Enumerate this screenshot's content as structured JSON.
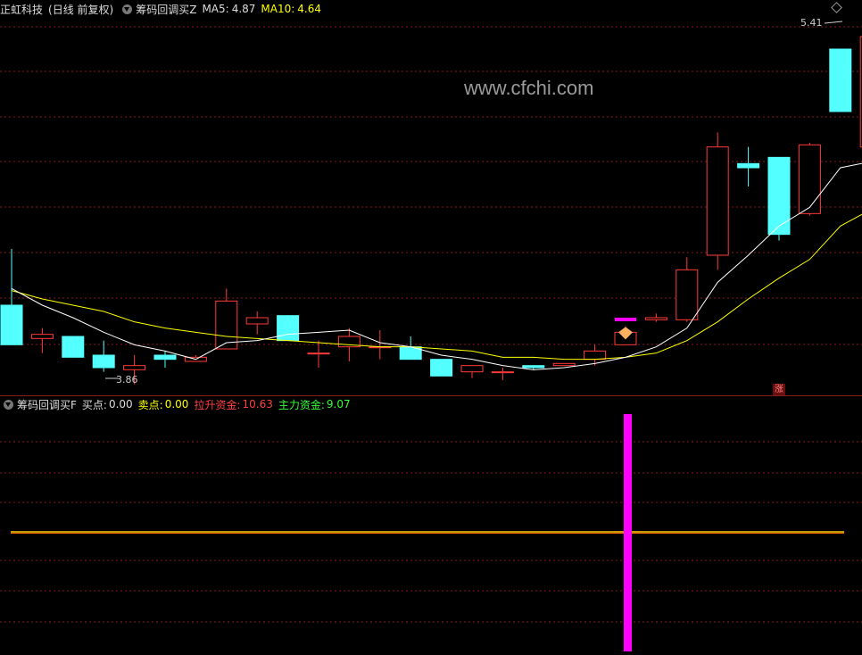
{
  "header": {
    "stock": "正虹科技",
    "period": "(日线 前复权)",
    "indicator": "筹码回调买Z",
    "ma5_label": "MA5:",
    "ma5_value": "4.87",
    "ma10_label": "MA10:",
    "ma10_value": "4.64"
  },
  "watermark": "www.cfchi.com",
  "annotations": {
    "high": "5.41",
    "low": "3.86",
    "zhang": "涨"
  },
  "sub_header": {
    "indicator": "筹码回调买F",
    "buy_label": "买点:",
    "buy_value": "0.00",
    "sell_label": "卖点:",
    "sell_value": "0.00",
    "lift_label": "拉升资金:",
    "lift_value": "10.63",
    "main_label": "主力资金:",
    "main_value": "9.07"
  },
  "chart_data": {
    "type": "candlestick",
    "colors": {
      "up": "#ff3a3a",
      "down": "#54ffff",
      "ma5": "#ffffff",
      "ma10": "#ffff00",
      "grid": "#8a1c1c",
      "signal": "#ff00ff"
    },
    "candles": [
      {
        "o": 4.18,
        "h": 4.45,
        "l": 4.04,
        "c": 3.99
      },
      {
        "o": 4.02,
        "h": 4.07,
        "l": 3.95,
        "c": 4.04
      },
      {
        "o": 4.03,
        "h": 4.03,
        "l": 3.97,
        "c": 3.93
      },
      {
        "o": 3.94,
        "h": 4.01,
        "l": 3.86,
        "c": 3.88
      },
      {
        "o": 3.87,
        "h": 3.94,
        "l": 3.8,
        "c": 3.89
      },
      {
        "o": 3.94,
        "h": 3.96,
        "l": 3.88,
        "c": 3.92
      },
      {
        "o": 3.91,
        "h": 3.94,
        "l": 3.91,
        "c": 3.93
      },
      {
        "o": 3.97,
        "h": 4.26,
        "l": 3.97,
        "c": 4.2
      },
      {
        "o": 4.09,
        "h": 4.15,
        "l": 4.04,
        "c": 4.12
      },
      {
        "o": 4.13,
        "h": 4.13,
        "l": 4.01,
        "c": 4.01
      },
      {
        "o": 3.95,
        "h": 4.01,
        "l": 3.88,
        "c": 3.95
      },
      {
        "o": 3.98,
        "h": 4.07,
        "l": 3.91,
        "c": 4.03
      },
      {
        "o": 3.98,
        "h": 4.06,
        "l": 3.92,
        "c": 3.98
      },
      {
        "o": 3.98,
        "h": 4.03,
        "l": 3.92,
        "c": 3.92
      },
      {
        "o": 3.92,
        "h": 3.92,
        "l": 3.84,
        "c": 3.84
      },
      {
        "o": 3.86,
        "h": 3.89,
        "l": 3.83,
        "c": 3.89
      },
      {
        "o": 3.86,
        "h": 3.88,
        "l": 3.82,
        "c": 3.86
      },
      {
        "o": 3.89,
        "h": 3.89,
        "l": 3.87,
        "c": 3.88
      },
      {
        "o": 3.89,
        "h": 3.9,
        "l": 3.89,
        "c": 3.9
      },
      {
        "o": 3.92,
        "h": 3.99,
        "l": 3.89,
        "c": 3.96
      },
      {
        "o": 3.99,
        "h": 4.08,
        "l": 3.99,
        "c": 4.05
      },
      {
        "o": 4.11,
        "h": 4.14,
        "l": 4.1,
        "c": 4.12
      },
      {
        "o": 4.11,
        "h": 4.41,
        "l": 4.1,
        "c": 4.35
      },
      {
        "o": 4.42,
        "h": 5.01,
        "l": 4.35,
        "c": 4.94
      },
      {
        "o": 4.86,
        "h": 4.94,
        "l": 4.75,
        "c": 4.84
      },
      {
        "o": 4.89,
        "h": 4.89,
        "l": 4.49,
        "c": 4.52
      },
      {
        "o": 4.62,
        "h": 4.96,
        "l": 4.61,
        "c": 4.95
      },
      {
        "o": 5.41,
        "h": 5.41,
        "l": 5.11,
        "c": 5.11
      },
      {
        "o": 4.94,
        "h": 5.44,
        "l": 4.77,
        "c": 5.47
      }
    ],
    "ma5": [
      4.26,
      4.18,
      4.12,
      4.05,
      3.99,
      3.96,
      3.92,
      4.0,
      4.01,
      4.04,
      4.05,
      4.06,
      4.0,
      3.98,
      3.94,
      3.92,
      3.89,
      3.87,
      3.88,
      3.9,
      3.93,
      3.98,
      4.07,
      4.29,
      4.42,
      4.56,
      4.65,
      4.84,
      4.87
    ],
    "ma10": [
      4.25,
      4.21,
      4.18,
      4.15,
      4.1,
      4.07,
      4.05,
      4.03,
      4.02,
      4.01,
      4.0,
      3.99,
      3.98,
      3.98,
      3.97,
      3.96,
      3.93,
      3.93,
      3.92,
      3.92,
      3.93,
      3.95,
      4.01,
      4.1,
      4.21,
      4.31,
      4.4,
      4.56,
      4.64
    ],
    "ylim": [
      3.76,
      5.56
    ],
    "signal_bar_index": 20,
    "sub_lines": {
      "yellow": 0.0,
      "orange": 0.0
    }
  }
}
